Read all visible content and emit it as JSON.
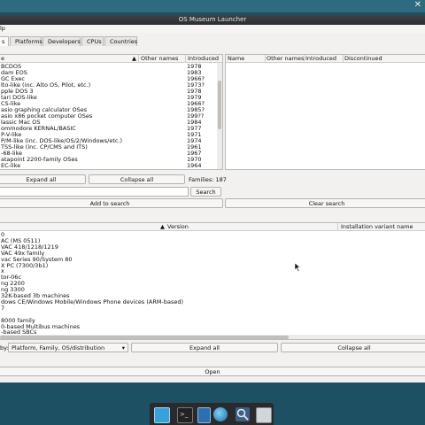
{
  "window": {
    "title": "OS Museum Launcher"
  },
  "menu": {
    "help": "lp"
  },
  "tabs": [
    {
      "label": "s"
    },
    {
      "label": "Platforms"
    },
    {
      "label": "Developers"
    },
    {
      "label": "CPUs"
    },
    {
      "label": "Countries"
    }
  ],
  "families_table": {
    "columns": {
      "name": "e",
      "other_names": "Other names",
      "introduced": "Introduced"
    },
    "rows": [
      {
        "name": "BCDOS",
        "introduced": "1978"
      },
      {
        "name": "dam EOS",
        "introduced": "1983"
      },
      {
        "name": "GC Exec",
        "introduced": "1966?"
      },
      {
        "name": "lto-like (inc. Alto OS, Pilot, etc.)",
        "introduced": "1973?"
      },
      {
        "name": "pple DOS 3",
        "introduced": "1978"
      },
      {
        "name": "tari DOS-like",
        "introduced": "1979"
      },
      {
        "name": "CS-like",
        "introduced": "1966?"
      },
      {
        "name": "asio graphing calculator OSes",
        "introduced": "1985?"
      },
      {
        "name": "asio x86 pocket computer OSes",
        "introduced": "199??"
      },
      {
        "name": "lassic Mac OS",
        "introduced": "1984"
      },
      {
        "name": "ommodore KERNAL/BASIC",
        "introduced": "1977"
      },
      {
        "name": "P-V-like",
        "introduced": "1971"
      },
      {
        "name": "P/M-like (inc. DOS-like/OS/2/Windows/etc.)",
        "introduced": "1974"
      },
      {
        "name": "TSS-like (inc. CP/CMS and ITS)",
        "introduced": "1961"
      },
      {
        "name": "-68-like",
        "introduced": "1967"
      },
      {
        "name": "atapoint 2200-family OSes",
        "introduced": "1970"
      },
      {
        "name": "EC-like",
        "introduced": "1964"
      }
    ]
  },
  "right_table": {
    "columns": {
      "name": "Name",
      "other_names": "Other names",
      "introduced": "Introduced",
      "discontinued": "Discontinued"
    }
  },
  "families_controls": {
    "expand_all": "Expand all",
    "collapse_all": "Collapse all",
    "families_count": "Families: 187",
    "search_button": "Search",
    "search_value": ""
  },
  "actions": {
    "add_to_search": "Add to search",
    "clear_search": "Clear search"
  },
  "results_table": {
    "columns": {
      "name": "",
      "version": "Version",
      "installation_variant": "Installation variant name"
    },
    "rows": [
      {
        "name": "0"
      },
      {
        "name": "AC (MS 0511)"
      },
      {
        "name": "VAC 418/1218/1219"
      },
      {
        "name": "VAC 49x family"
      },
      {
        "name": "vac Series 90/System 80"
      },
      {
        "name": "X PC (7300/3b1)"
      },
      {
        "name": "x"
      },
      {
        "name": "tor-06c"
      },
      {
        "name": "ng 2200"
      },
      {
        "name": "ng 3300"
      },
      {
        "name": "32K-based 3b machines"
      },
      {
        "name": "dows CE/Windows Mobile/Windows Phone devices (ARM-based)"
      },
      {
        "name": "7"
      },
      {
        "name": ""
      },
      {
        "name": "8000 family"
      },
      {
        "name": "0-based Multibus machines"
      },
      {
        "name": "-based SBCs"
      }
    ]
  },
  "bottom_controls": {
    "group_by_label": "by:",
    "group_by_value": "Platform, Family, OS/distribution",
    "expand_all": "Expand all",
    "collapse_all": "Collapse all",
    "open": "Open"
  },
  "icons": {
    "close": "close-icon",
    "sort": "sort-arrow-icon",
    "dropdown": "chevron-down-icon"
  },
  "colors": {
    "desktop": "#1e5063",
    "titlebar": "#2b2e32",
    "dock": "#2a2a2c",
    "accent": "#3aa0d8"
  }
}
